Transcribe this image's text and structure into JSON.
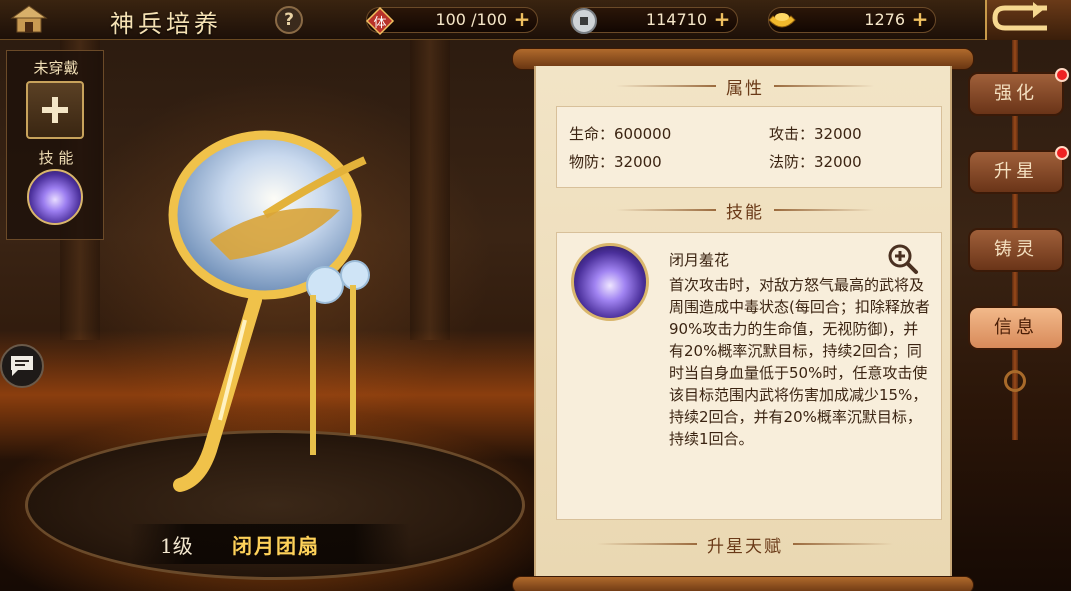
{
  "header": {
    "title": "神兵培养",
    "help": "?",
    "stamina_label": "体",
    "stamina": "100 /100",
    "silver": "114710",
    "gold": "1276",
    "plus": "+"
  },
  "equip": {
    "unequipped_label": "未穿戴",
    "skill_label": "技 能"
  },
  "weapon": {
    "level": "1级",
    "name": "闭月团扇"
  },
  "panel": {
    "attr_title": "属性",
    "attributes": [
      "生命：600000",
      "攻击：32000",
      "物防：32000",
      "法防：32000"
    ],
    "skill_title": "技能",
    "skill_name": "闭月羞花",
    "skill_desc": "首次攻击时，对敌方怒气最高的武将及周围造成中毒状态(每回合；扣除释放者90%攻击力的生命值，无视防御)，并有20%概率沉默目标，持续2回合；同时当自身血量低于50%时，任意攻击使该目标范围内武将伤害加成减少15%，持续2回合，并有20%概率沉默目标，持续1回合。",
    "star_title": "升星天赋"
  },
  "tabs": [
    {
      "label": "强化",
      "badge": true
    },
    {
      "label": "升星",
      "badge": true
    },
    {
      "label": "铸灵",
      "badge": false
    },
    {
      "label": "信息",
      "badge": false,
      "active": true
    }
  ],
  "colors": {
    "accent_gold": "#ffd25a",
    "badge_red": "#e22222",
    "paper": "#f2e4c6"
  }
}
